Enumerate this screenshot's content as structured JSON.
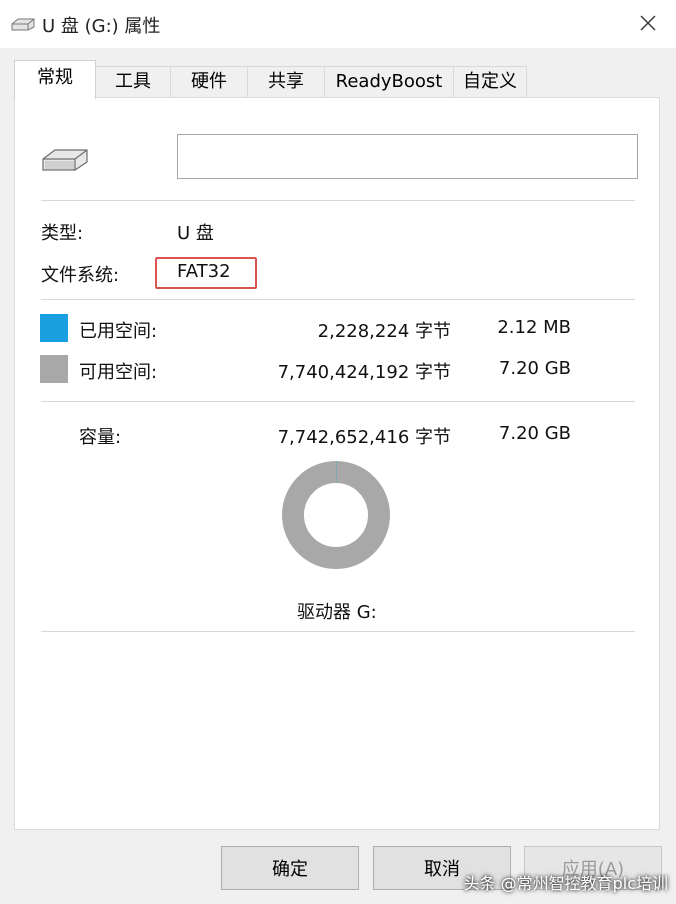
{
  "window": {
    "title": "U 盘 (G:) 属性"
  },
  "tabs": [
    {
      "label": "常规"
    },
    {
      "label": "工具"
    },
    {
      "label": "硬件"
    },
    {
      "label": "共享"
    },
    {
      "label": "ReadyBoost"
    },
    {
      "label": "自定义"
    }
  ],
  "general": {
    "name_value": "",
    "type_label": "类型:",
    "type_value": "U 盘",
    "fs_label": "文件系统:",
    "fs_value": "FAT32",
    "used": {
      "label": "已用空间:",
      "bytes": "2,228,224 字节",
      "size": "2.12 MB",
      "color": "#1a9fe0"
    },
    "free": {
      "label": "可用空间:",
      "bytes": "7,740,424,192 字节",
      "size": "7.20 GB",
      "color": "#a8a8a8"
    },
    "capacity": {
      "label": "容量:",
      "bytes": "7,742,652,416 字节",
      "size": "7.20 GB"
    },
    "drive_label": "驱动器 G:",
    "used_fraction": 0.0003
  },
  "buttons": {
    "ok": "确定",
    "cancel": "取消",
    "apply": "应用(A)"
  },
  "watermark": "头条 @常州智控教育plc培训"
}
